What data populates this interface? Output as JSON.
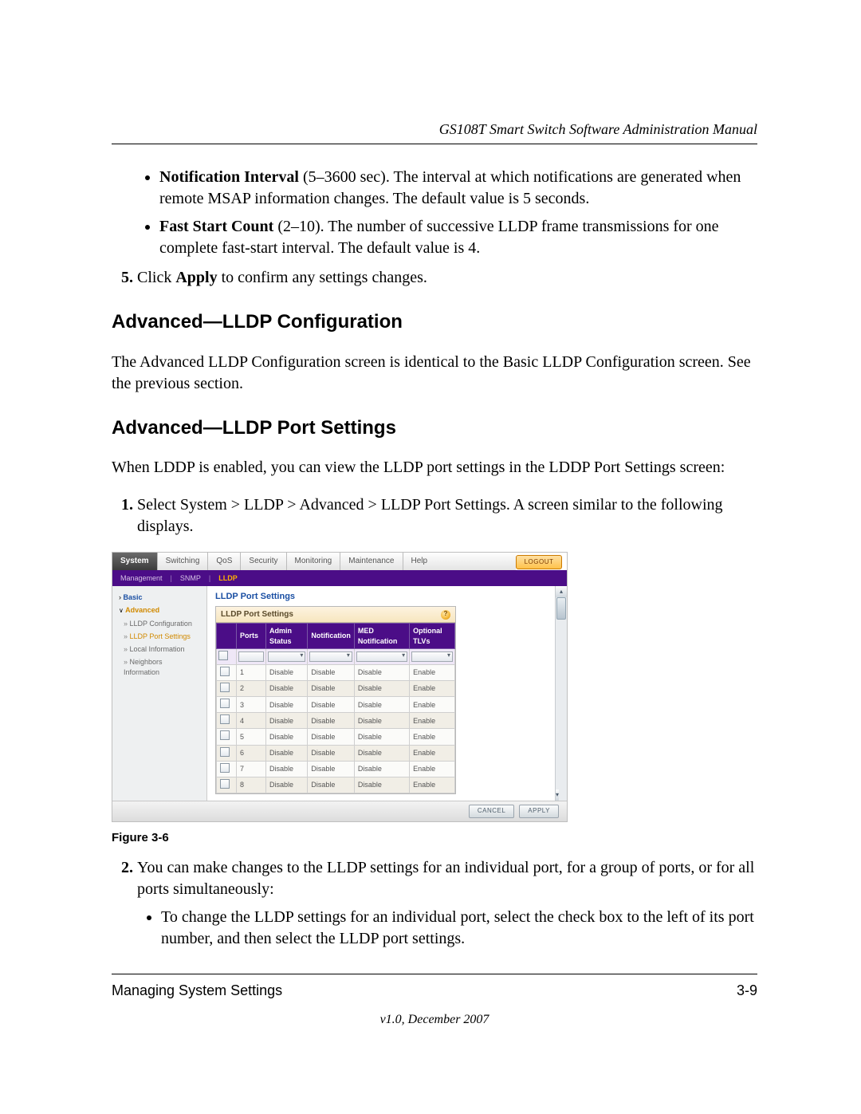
{
  "header": {
    "running_title": "GS108T Smart Switch Software Administration Manual"
  },
  "intro_bullets": {
    "b1_label": "Notification Interval",
    "b1_text": " (5–3600 sec). The interval at which notifications are generated when remote MSAP information changes. The default value is 5 seconds.",
    "b2_label": "Fast Start Count",
    "b2_text": " (2–10). The number of successive LLDP frame transmissions for one complete fast-start interval. The default value is 4."
  },
  "step5": {
    "pre": "Click ",
    "bold": "Apply",
    "post": " to confirm any settings changes."
  },
  "section1": {
    "title": "Advanced—LLDP Configuration",
    "para": "The Advanced LLDP Configuration screen is identical to the Basic LLDP Configuration screen. See the previous section."
  },
  "section2": {
    "title": "Advanced—LLDP Port Settings",
    "para": "When LDDP is enabled, you can view the LLDP port settings in the LDDP Port Settings screen:",
    "step1": "Select System > LLDP > Advanced > LLDP Port Settings. A screen similar to the following displays."
  },
  "ui": {
    "tabs": [
      "System",
      "Switching",
      "QoS",
      "Security",
      "Monitoring",
      "Maintenance",
      "Help"
    ],
    "active_tab": "System",
    "logout": "LOGOUT",
    "subnav": [
      "Management",
      "SNMP",
      "LLDP"
    ],
    "subnav_active": "LLDP",
    "sidebar": {
      "basic": "Basic",
      "advanced": "Advanced",
      "items": [
        "LLDP Configuration",
        "LLDP Port Settings",
        "Local Information",
        "Neighbors Information"
      ],
      "active": "LLDP Port Settings"
    },
    "panel_title": "LLDP Port Settings",
    "panel_head": "LLDP Port Settings",
    "columns": [
      "",
      "Ports",
      "Admin Status",
      "Notification",
      "MED Notification",
      "Optional TLVs"
    ],
    "rows": [
      {
        "port": "1",
        "admin": "Disable",
        "notif": "Disable",
        "med": "Disable",
        "tlv": "Enable"
      },
      {
        "port": "2",
        "admin": "Disable",
        "notif": "Disable",
        "med": "Disable",
        "tlv": "Enable"
      },
      {
        "port": "3",
        "admin": "Disable",
        "notif": "Disable",
        "med": "Disable",
        "tlv": "Enable"
      },
      {
        "port": "4",
        "admin": "Disable",
        "notif": "Disable",
        "med": "Disable",
        "tlv": "Enable"
      },
      {
        "port": "5",
        "admin": "Disable",
        "notif": "Disable",
        "med": "Disable",
        "tlv": "Enable"
      },
      {
        "port": "6",
        "admin": "Disable",
        "notif": "Disable",
        "med": "Disable",
        "tlv": "Enable"
      },
      {
        "port": "7",
        "admin": "Disable",
        "notif": "Disable",
        "med": "Disable",
        "tlv": "Enable"
      },
      {
        "port": "8",
        "admin": "Disable",
        "notif": "Disable",
        "med": "Disable",
        "tlv": "Enable"
      }
    ],
    "buttons": {
      "cancel": "CANCEL",
      "apply": "APPLY"
    }
  },
  "figure_caption": "Figure 3-6",
  "post": {
    "step2": "You can make changes to the LLDP settings for an individual port, for a group of ports, or for all ports simultaneously:",
    "sub_bullet": "To change the LLDP settings for an individual port, select the check box to the left of its port number, and then select the LLDP port settings."
  },
  "footer": {
    "left": "Managing System Settings",
    "right": "3-9",
    "version": "v1.0, December 2007"
  }
}
